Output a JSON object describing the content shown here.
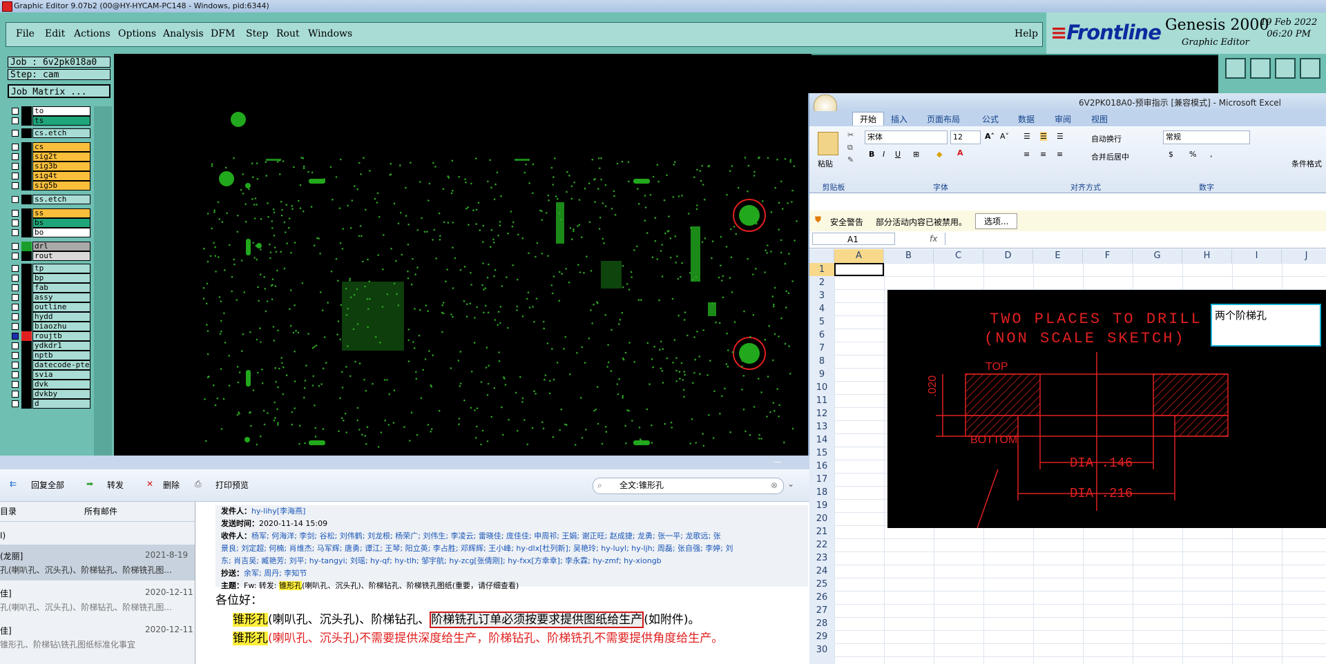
{
  "titlebar": {
    "title": "Graphic Editor 9.07b2 (00@HY-HYCAM-PC148 - Windows, pid:6344)"
  },
  "genesis_menu": {
    "items": [
      "File",
      "Edit",
      "Actions",
      "Options",
      "Analysis",
      "DFM",
      "Step",
      "Rout",
      "Windows"
    ],
    "help": "Help"
  },
  "brand": {
    "logo": "Frontline",
    "product": "Genesis 2000",
    "sub": "Graphic Editor",
    "date": "19 Feb 2022",
    "time": "06:20 PM"
  },
  "job": {
    "job_label": "Job : 6v2pk018a0",
    "step_label": "Step: cam",
    "matrix_button": "Job Matrix ..."
  },
  "layers": [
    {
      "name": "to",
      "color": "#ffffff"
    },
    {
      "name": "ts",
      "color": "#1fa57a"
    },
    {
      "name": "cs.etch",
      "color": "#a8dcd5"
    },
    {
      "name": "cs",
      "color": "#f9bf3b"
    },
    {
      "name": "sig2t",
      "color": "#f9bf3b"
    },
    {
      "name": "sig3b",
      "color": "#f9bf3b"
    },
    {
      "name": "sig4t",
      "color": "#f9bf3b"
    },
    {
      "name": "sig5b",
      "color": "#f9bf3b"
    },
    {
      "name": "ss.etch",
      "color": "#a8dcd5"
    },
    {
      "name": "ss",
      "color": "#f9bf3b"
    },
    {
      "name": "bs",
      "color": "#1fa57a"
    },
    {
      "name": "bo",
      "color": "#ffffff"
    },
    {
      "name": "drl",
      "color": "#a9a9a9"
    },
    {
      "name": "rout",
      "color": "#d9d9d9"
    },
    {
      "name": "tp",
      "color": "#a8dcd5"
    },
    {
      "name": "bp",
      "color": "#a8dcd5"
    },
    {
      "name": "fab",
      "color": "#a8dcd5"
    },
    {
      "name": "assy",
      "color": "#a8dcd5"
    },
    {
      "name": "outline",
      "color": "#a8dcd5"
    },
    {
      "name": "hydd",
      "color": "#a8dcd5"
    },
    {
      "name": "biaozhu",
      "color": "#a8dcd5"
    },
    {
      "name": "roujtb",
      "color": "#a8dcd5"
    },
    {
      "name": "ydkdr1",
      "color": "#a8dcd5"
    },
    {
      "name": "nptb",
      "color": "#a8dcd5"
    },
    {
      "name": "datecode-pte",
      "color": "#a8dcd5"
    },
    {
      "name": "svia",
      "color": "#a8dcd5"
    },
    {
      "name": "dvk",
      "color": "#a8dcd5"
    },
    {
      "name": "dvkby",
      "color": "#a8dcd5"
    },
    {
      "name": "d",
      "color": "#a8dcd5"
    }
  ],
  "excel": {
    "title": "6V2PK018A0-预审指示 [兼容模式] - Microsoft Excel",
    "tabs": [
      "开始",
      "插入",
      "页面布局",
      "公式",
      "数据",
      "审阅",
      "视图"
    ],
    "font_name": "宋体",
    "font_size": "12",
    "number_format": "常规",
    "groups": {
      "clipboard": "剪贴板",
      "font": "字体",
      "align": "对齐方式",
      "number": "数字"
    },
    "paste": "粘贴",
    "wrap": "自动换行",
    "merge": "合并后居中",
    "cond": "条件格式",
    "security_title": "安全警告",
    "security_text": "部分活动内容已被禁用。",
    "options_button": "选项...",
    "name_box": "A1",
    "fx": "fx",
    "columns": [
      "A",
      "B",
      "C",
      "D",
      "E",
      "F",
      "G",
      "H",
      "I",
      "J"
    ],
    "rows": [
      "1",
      "2",
      "3",
      "4",
      "5",
      "6",
      "7",
      "8",
      "9",
      "10",
      "11",
      "12",
      "13",
      "14",
      "15",
      "16",
      "17",
      "18",
      "19",
      "20",
      "21",
      "22",
      "23",
      "24",
      "25",
      "26",
      "27",
      "28",
      "29",
      "30"
    ],
    "note": "两个阶梯孔",
    "drawing": {
      "title1": "TWO PLACES TO DRILL",
      "title2": "(NON SCALE SKETCH)",
      "top": "TOP",
      "bottom": "BOTTOM",
      "dim_v": ".020",
      "dia1": "DIA .146",
      "dia2": "DIA .216"
    }
  },
  "mail": {
    "toolbar": {
      "reply_all": "回复全部",
      "forward": "转发",
      "delete": "删除",
      "print": "打印预览"
    },
    "search": "全文:锥形孔",
    "list_tabs": [
      "目录",
      "所有邮件"
    ],
    "list_root": "I)",
    "items": [
      {
        "sender": "(龙丽]",
        "date": "2021-8-19",
        "subject": "孔(喇叭孔、沉头孔)、阶梯钻孔、阶梯铣孔图..."
      },
      {
        "sender": "佳]",
        "date": "2020-12-11",
        "subject": "孔(喇叭孔、沉头孔)、阶梯钻孔、阶梯铣孔图..."
      },
      {
        "sender": "佳]",
        "date": "2020-12-11",
        "subject": "锥形孔、阶梯钻\\铣孔图纸标准化事宜"
      }
    ],
    "header": {
      "from_label": "发件人：",
      "from": "hy-lihy[李海燕]",
      "time_label": "发送时间：",
      "time": "2020-11-14 15:09",
      "to_label": "收件人：",
      "to1": "杨军; 何海洋; 李剑; 谷松; 刘伟鹤; 刘龙根; 杨荣广; 刘伟生; 李凌云; 雷晓佳; 庞佳佳; 申周祁; 王娟; 谢正旺; 赵成捷; 龙勇; 张一平; 龙歌远; 张",
      "to2": "景良; 刘定超; 何楠; 肖维杰; 马军辉; 唐勇; 谭江; 王琴; 阳立英; 李占胜; 邓辉辉; 王小峰; hy-dlx[杜列新]; 吴艳玲; hy-luyl; hy-ljh; 周磊; 张自强; 李婷; 刘",
      "to3": "东; 肖吉吴; 臧艳芳; 刘平; hy-tangyi; 刘瑶; hy-qf; hy-tlh; 邹宇航; hy-zcg[张倩刚]; hy-fxx[方幸幸]; 李永霖; hy-zmf; hy-xiongb",
      "cc_label": "抄送：",
      "cc": "余军; 周丹; 李知节",
      "subj_label": "主题：",
      "subj_prefix": "Fw: 转发: ",
      "subj_hl": "锥形孔",
      "subj_rest": "(喇叭孔、沉头孔)、阶梯钻孔、阶梯铣孔图纸(重要，请仔细查看)"
    },
    "body": {
      "greeting": "各位好：",
      "l1_hl": "锥形孔",
      "l1_a": "(喇叭孔、沉头孔)、阶梯钻孔、",
      "l1_box": "阶梯铣孔订单必须按要求提供图纸给生产",
      "l1_b": "(如附件)。",
      "l2_hl": "锥形孔",
      "l2_red": "(喇叭孔、沉头孔)不需要提供深度给生产，阶梯钻孔、阶梯铣孔不需要提供角度给生产。"
    }
  }
}
